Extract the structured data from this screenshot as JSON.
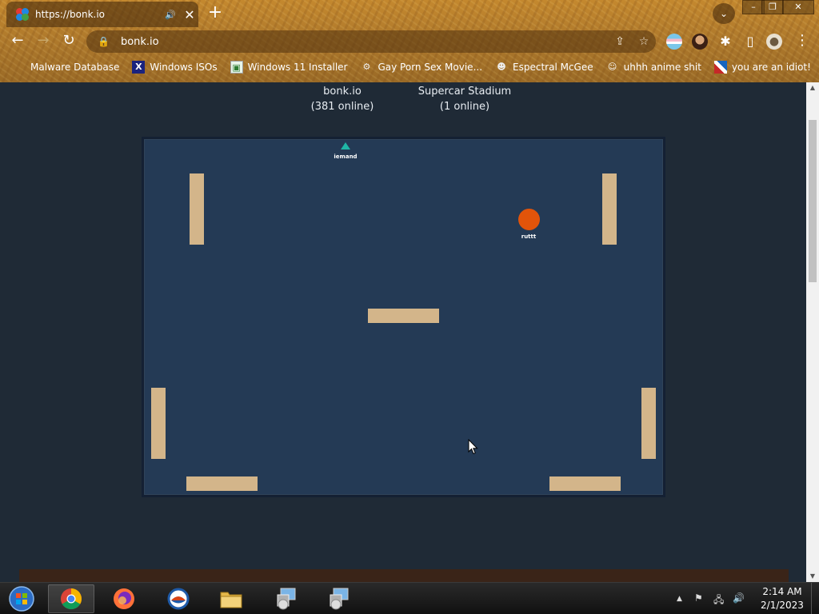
{
  "browser": {
    "tab_title": "https://bonk.io",
    "url": "bonk.io",
    "bookmarks": [
      {
        "label": "Malware Database",
        "icon": "blank-icon"
      },
      {
        "label": "Windows ISOs",
        "icon": "x-logo-icon"
      },
      {
        "label": "Windows 11 Installer",
        "icon": "image-icon"
      },
      {
        "label": "Gay Porn Sex Movie...",
        "icon": "site-icon"
      },
      {
        "label": "Espectral McGee",
        "icon": "site-icon"
      },
      {
        "label": "uhhh anime shit",
        "icon": "anime-icon"
      },
      {
        "label": "you are an idiot!",
        "icon": "flag-icon"
      }
    ]
  },
  "page": {
    "server_name": "bonk.io",
    "server_online": "(381 online)",
    "room_name": "Supercar Stadium",
    "room_online": "(1 online)"
  },
  "game": {
    "players": [
      {
        "name": "iemand",
        "marker": "teal-arrow"
      },
      {
        "name": "ruttt",
        "marker": "orange-ball"
      }
    ],
    "colors": {
      "background": "#243a55",
      "platform": "#d3b58a",
      "ball": "#e2540a",
      "arrow": "#1fb6a6"
    }
  },
  "taskbar": {
    "apps": [
      "start-icon",
      "chrome-icon",
      "firefox-icon",
      "internet-explorer-icon",
      "file-explorer-icon",
      "installer-icon",
      "installer-icon"
    ],
    "time": "2:14 AM",
    "date": "2/1/2023"
  }
}
